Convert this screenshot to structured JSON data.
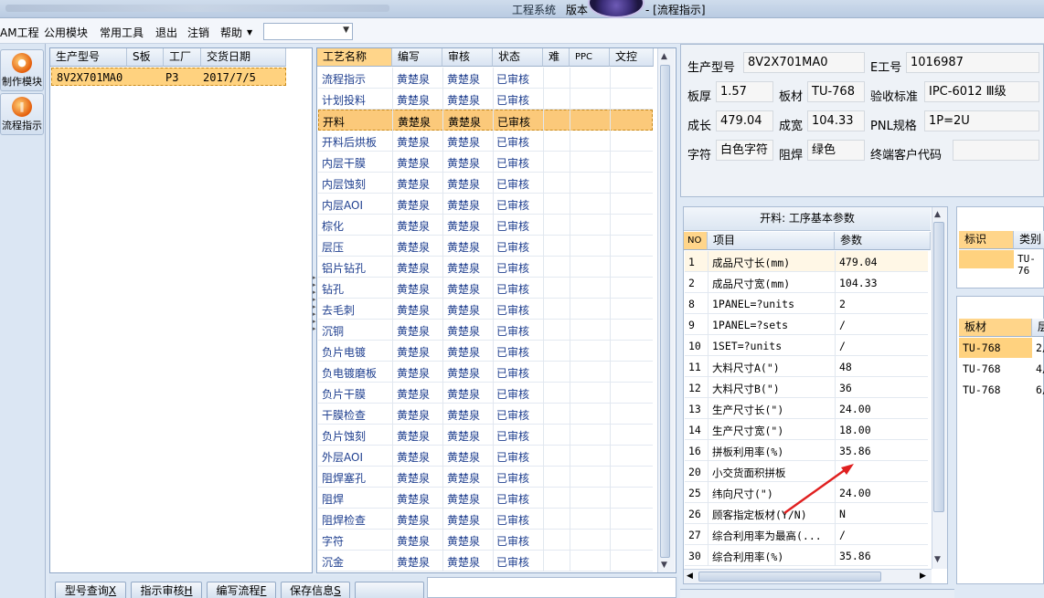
{
  "title": {
    "app": "工程系统",
    "version_label": "版本",
    "subtitle": "- [流程指示]"
  },
  "menu": [
    "AM工程",
    "公用模块",
    "常用工具",
    "退出",
    "注销",
    "帮助"
  ],
  "menu_combo": {
    "value": ""
  },
  "leftnav": [
    {
      "label": "制作模块",
      "icon": "fire-icon"
    },
    {
      "label": "流程指示",
      "icon": "pause-icon"
    }
  ],
  "orders": {
    "headers": [
      "生产型号",
      "S板",
      "工厂",
      "交货日期"
    ],
    "rows": [
      {
        "model": "8V2X701MA0",
        "s": "",
        "factory": "P3",
        "date": "2017/7/5"
      }
    ]
  },
  "process": {
    "headers": [
      "工艺名称",
      "编写",
      "审核",
      "状态",
      "难",
      "PPC",
      "文控"
    ],
    "rows": [
      {
        "name": "流程指示",
        "writer": "黄楚泉",
        "reviewer": "黄楚泉",
        "status": "已审核"
      },
      {
        "name": "计划投料",
        "writer": "黄楚泉",
        "reviewer": "黄楚泉",
        "status": "已审核"
      },
      {
        "name": "开料",
        "writer": "黄楚泉",
        "reviewer": "黄楚泉",
        "status": "已审核"
      },
      {
        "name": "开料后烘板",
        "writer": "黄楚泉",
        "reviewer": "黄楚泉",
        "status": "已审核"
      },
      {
        "name": "内层干膜",
        "writer": "黄楚泉",
        "reviewer": "黄楚泉",
        "status": "已审核"
      },
      {
        "name": "内层蚀刻",
        "writer": "黄楚泉",
        "reviewer": "黄楚泉",
        "status": "已审核"
      },
      {
        "name": "内层AOI",
        "writer": "黄楚泉",
        "reviewer": "黄楚泉",
        "status": "已审核"
      },
      {
        "name": "棕化",
        "writer": "黄楚泉",
        "reviewer": "黄楚泉",
        "status": "已审核"
      },
      {
        "name": "层压",
        "writer": "黄楚泉",
        "reviewer": "黄楚泉",
        "status": "已审核"
      },
      {
        "name": "铝片钻孔",
        "writer": "黄楚泉",
        "reviewer": "黄楚泉",
        "status": "已审核"
      },
      {
        "name": "钻孔",
        "writer": "黄楚泉",
        "reviewer": "黄楚泉",
        "status": "已审核"
      },
      {
        "name": "去毛刺",
        "writer": "黄楚泉",
        "reviewer": "黄楚泉",
        "status": "已审核"
      },
      {
        "name": "沉铜",
        "writer": "黄楚泉",
        "reviewer": "黄楚泉",
        "status": "已审核"
      },
      {
        "name": "负片电镀",
        "writer": "黄楚泉",
        "reviewer": "黄楚泉",
        "status": "已审核"
      },
      {
        "name": "负电镀磨板",
        "writer": "黄楚泉",
        "reviewer": "黄楚泉",
        "status": "已审核"
      },
      {
        "name": "负片干膜",
        "writer": "黄楚泉",
        "reviewer": "黄楚泉",
        "status": "已审核"
      },
      {
        "name": "干膜检查",
        "writer": "黄楚泉",
        "reviewer": "黄楚泉",
        "status": "已审核"
      },
      {
        "name": "负片蚀刻",
        "writer": "黄楚泉",
        "reviewer": "黄楚泉",
        "status": "已审核"
      },
      {
        "name": "外层AOI",
        "writer": "黄楚泉",
        "reviewer": "黄楚泉",
        "status": "已审核"
      },
      {
        "name": "阻焊塞孔",
        "writer": "黄楚泉",
        "reviewer": "黄楚泉",
        "status": "已审核"
      },
      {
        "name": "阻焊",
        "writer": "黄楚泉",
        "reviewer": "黄楚泉",
        "status": "已审核"
      },
      {
        "name": "阻焊检查",
        "writer": "黄楚泉",
        "reviewer": "黄楚泉",
        "status": "已审核"
      },
      {
        "name": "字符",
        "writer": "黄楚泉",
        "reviewer": "黄楚泉",
        "status": "已审核"
      },
      {
        "name": "沉金",
        "writer": "黄楚泉",
        "reviewer": "黄楚泉",
        "status": "已审核"
      }
    ]
  },
  "info": {
    "model_label": "生产型号",
    "model": "8V2X701MA0",
    "eno_label": "E工号",
    "eno": "1016987",
    "thick_label": "板厚",
    "thick": "1.57",
    "material_label": "板材",
    "material": "TU-768",
    "std_label": "验收标准",
    "std": "IPC-6012 Ⅲ级",
    "len_label": "成长",
    "len": "479.04",
    "wid_label": "成宽",
    "wid": "104.33",
    "pnl_label": "PNL规格",
    "pnl": "1P=2U",
    "char_label": "字符",
    "char": "白色字符",
    "mask_label": "阻焊",
    "mask": "绿色",
    "cust_label": "终端客户代码",
    "cust": ""
  },
  "params": {
    "title": "开料: 工序基本参数",
    "headers": [
      "NO",
      "项目",
      "参数"
    ],
    "rows": [
      {
        "no": "1",
        "item": "成品尺寸长(mm)",
        "val": "479.04"
      },
      {
        "no": "2",
        "item": "成品尺寸宽(mm)",
        "val": "104.33"
      },
      {
        "no": "8",
        "item": "1PANEL=?units",
        "val": "2"
      },
      {
        "no": "9",
        "item": "1PANEL=?sets",
        "val": "/"
      },
      {
        "no": "10",
        "item": "1SET=?units",
        "val": "/"
      },
      {
        "no": "11",
        "item": "大料尺寸A(\")",
        "val": "48"
      },
      {
        "no": "12",
        "item": "大料尺寸B(\")",
        "val": "36"
      },
      {
        "no": "13",
        "item": "生产尺寸长(\")",
        "val": "24.00"
      },
      {
        "no": "14",
        "item": "生产尺寸宽(\")",
        "val": "18.00"
      },
      {
        "no": "16",
        "item": "拼板利用率(%)",
        "val": "35.86"
      },
      {
        "no": "20",
        "item": "小交货面积拼板",
        "val": ""
      },
      {
        "no": "25",
        "item": "纬向尺寸(\")",
        "val": "24.00"
      },
      {
        "no": "26",
        "item": "顾客指定板材(Y/N)",
        "val": "N"
      },
      {
        "no": "27",
        "item": "综合利用率为最高(...",
        "val": "/"
      },
      {
        "no": "30",
        "item": "综合利用率(%)",
        "val": "35.86"
      }
    ]
  },
  "right_table1": {
    "headers": [
      "标识",
      "类别"
    ],
    "rows": [
      [
        "",
        "TU-76"
      ]
    ]
  },
  "right_table2": {
    "headers": [
      "板材",
      "层"
    ],
    "rows": [
      [
        "TU-768",
        "2/"
      ],
      [
        "TU-768",
        "4/"
      ],
      [
        "TU-768",
        "6/"
      ]
    ]
  },
  "bottom_buttons": [
    {
      "label": "型号查询",
      "key": "X"
    },
    {
      "label": "指示审核",
      "key": "H"
    },
    {
      "label": "编写流程",
      "key": "F"
    },
    {
      "label": "保存信息",
      "key": "S"
    },
    {
      "label": "",
      "key": ""
    }
  ],
  "colors": {
    "selection": "#fbc97a",
    "accent_text": "#1f3f8f",
    "annotation_arrow": "#e02020"
  }
}
